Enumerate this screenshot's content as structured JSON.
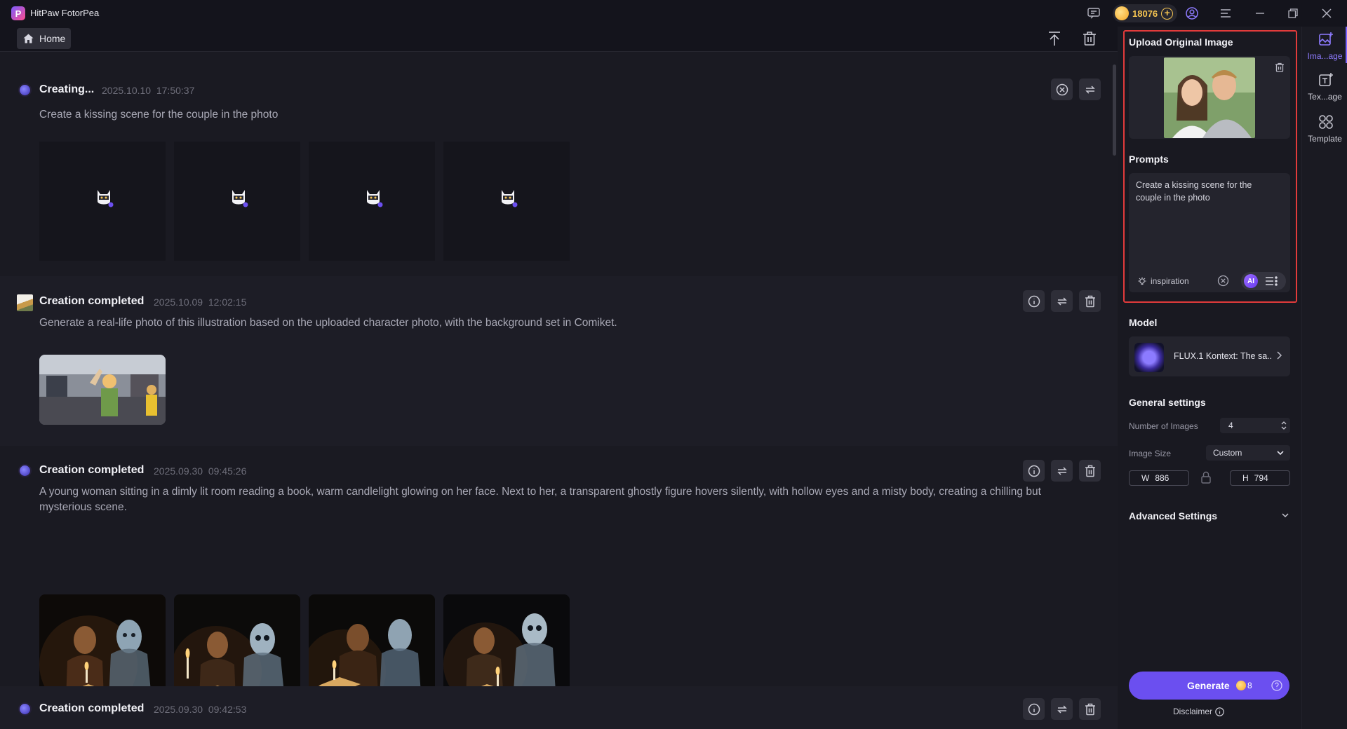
{
  "app": {
    "title": "HitPaw FotorPea",
    "logo_letter": "P"
  },
  "titlebar": {
    "coins": "18076",
    "add_label": "+"
  },
  "toolbar": {
    "home_label": "Home"
  },
  "cards": [
    {
      "status": "Creating...",
      "date": "2025.10.10",
      "time": "17:50:37",
      "prompt": "Create a kissing scene for the couple in the photo",
      "placeholder_count": 4
    },
    {
      "status": "Creation completed",
      "date": "2025.10.09",
      "time": "12:02:15",
      "prompt": "Generate a real-life photo of this illustration based on the uploaded character photo, with the background set in Comiket."
    },
    {
      "status": "Creation completed",
      "date": "2025.09.30",
      "time": "09:45:26",
      "prompt": "A young woman sitting in a dimly lit room reading a book, warm candlelight glowing on her face. Next to her, a transparent ghostly figure hovers silently, with hollow eyes and a misty body, creating a chilling but mysterious scene."
    },
    {
      "status": "Creation completed",
      "date": "2025.09.30",
      "time": "09:42:53"
    }
  ],
  "panel": {
    "upload_title": "Upload Original Image",
    "prompts_title": "Prompts",
    "prompt_text": "Create a kissing scene for the couple in the photo",
    "inspiration_label": "inspiration",
    "ai_label": "AI",
    "model_title": "Model",
    "model_name": "FLUX.1 Kontext: The sa...",
    "general_title": "General settings",
    "num_images_label": "Number of Images",
    "num_images_value": "4",
    "image_size_label": "Image Size",
    "image_size_value": "Custom",
    "width_label": "W",
    "width_value": "886",
    "height_label": "H",
    "height_value": "794",
    "advanced_title": "Advanced Settings",
    "generate_label": "Generate",
    "generate_cost": "8",
    "disclaimer_label": "Disclaimer"
  },
  "sidenav": {
    "items": [
      {
        "label": "Ima...age",
        "icon": "image-edit-icon",
        "active": true
      },
      {
        "label": "Tex...age",
        "icon": "text-to-image-icon",
        "active": false
      },
      {
        "label": "Template",
        "icon": "template-icon",
        "active": false
      }
    ]
  },
  "colors": {
    "accent": "#6b4ff0",
    "highlight": "#e23b3b",
    "coin": "#f5c451",
    "background": "#14141c"
  }
}
